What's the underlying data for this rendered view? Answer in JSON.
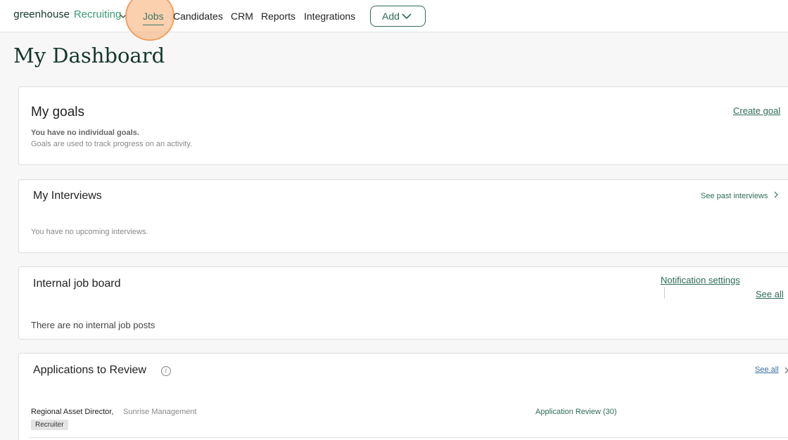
{
  "header": {
    "brand": "greenhouse",
    "product": "Recruiting",
    "nav": [
      "Jobs",
      "Candidates",
      "CRM",
      "Reports",
      "Integrations"
    ],
    "add_label": "Add"
  },
  "page": {
    "title": "My Dashboard"
  },
  "goals": {
    "title": "My goals",
    "create_link": "Create goal",
    "empty_title": "You have no individual goals.",
    "empty_desc": "Goals are used to track progress on an activity."
  },
  "interviews": {
    "title": "My Interviews",
    "past_link": "See past interviews",
    "empty": "You have no upcoming interviews."
  },
  "job_board": {
    "title": "Internal job board",
    "notification_link": "Notification settings",
    "see_all": "See all",
    "empty": "There are no internal job posts"
  },
  "applications": {
    "title": "Applications to Review",
    "see_all": "See all",
    "rows": [
      {
        "job": "Regional Asset Director,",
        "company": "Sunrise Management",
        "tag": "Recruiter",
        "stage": "Application Review (30)"
      }
    ]
  }
}
